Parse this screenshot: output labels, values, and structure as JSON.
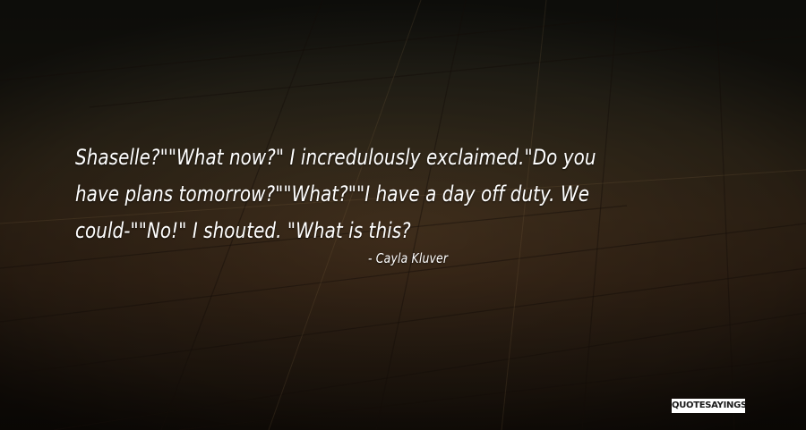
{
  "quote": {
    "text": "Shaselle?\"\"What now?\" I incredulously exclaimed.\"Do you\nhave plans tomorrow?\"\"What?\"\"I have a day off duty. We\ncould-\"\"No!\" I shouted. \"What is this?",
    "author": "- Cayla Kluver"
  },
  "watermark": {
    "text": "QUOTESAYINGS.NET"
  },
  "colors": {
    "text": "#ffffff",
    "background_dark": "#1c140c",
    "background_mid": "#3f2e1c"
  }
}
